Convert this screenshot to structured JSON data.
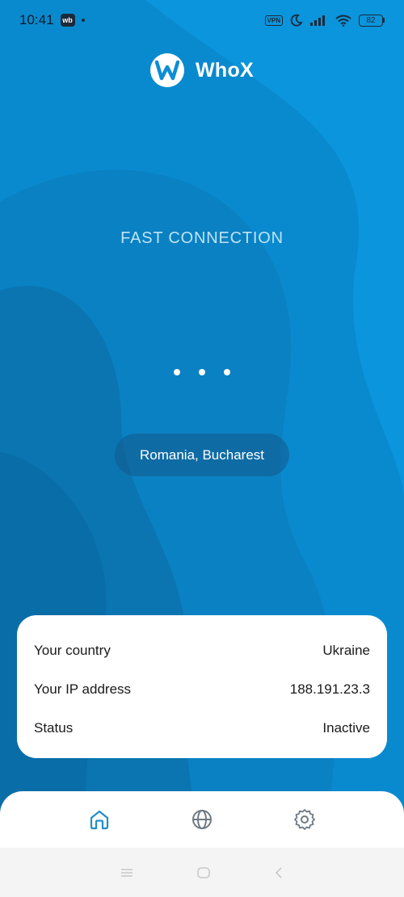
{
  "status_bar": {
    "time": "10:41",
    "app_badge": "wb",
    "vpn_label": "VPN",
    "battery": "82"
  },
  "brand": {
    "name": "WhoX",
    "logo_icon": "whox-logo-icon"
  },
  "connection": {
    "mode_label": "FAST CONNECTION",
    "location": "Romania, Bucharest"
  },
  "info": {
    "rows": [
      {
        "label": "Your country",
        "value": "Ukraine"
      },
      {
        "label": "Your IP address",
        "value": "188.191.23.3"
      },
      {
        "label": "Status",
        "value": "Inactive"
      }
    ]
  },
  "bottom_nav": {
    "items": [
      {
        "icon": "home-icon",
        "active": true
      },
      {
        "icon": "globe-icon",
        "active": false
      },
      {
        "icon": "gear-icon",
        "active": false
      }
    ]
  },
  "colors": {
    "background": "#0a8ed6",
    "accent": "#1f8fc9",
    "inactive_icon": "#6f7a85"
  }
}
